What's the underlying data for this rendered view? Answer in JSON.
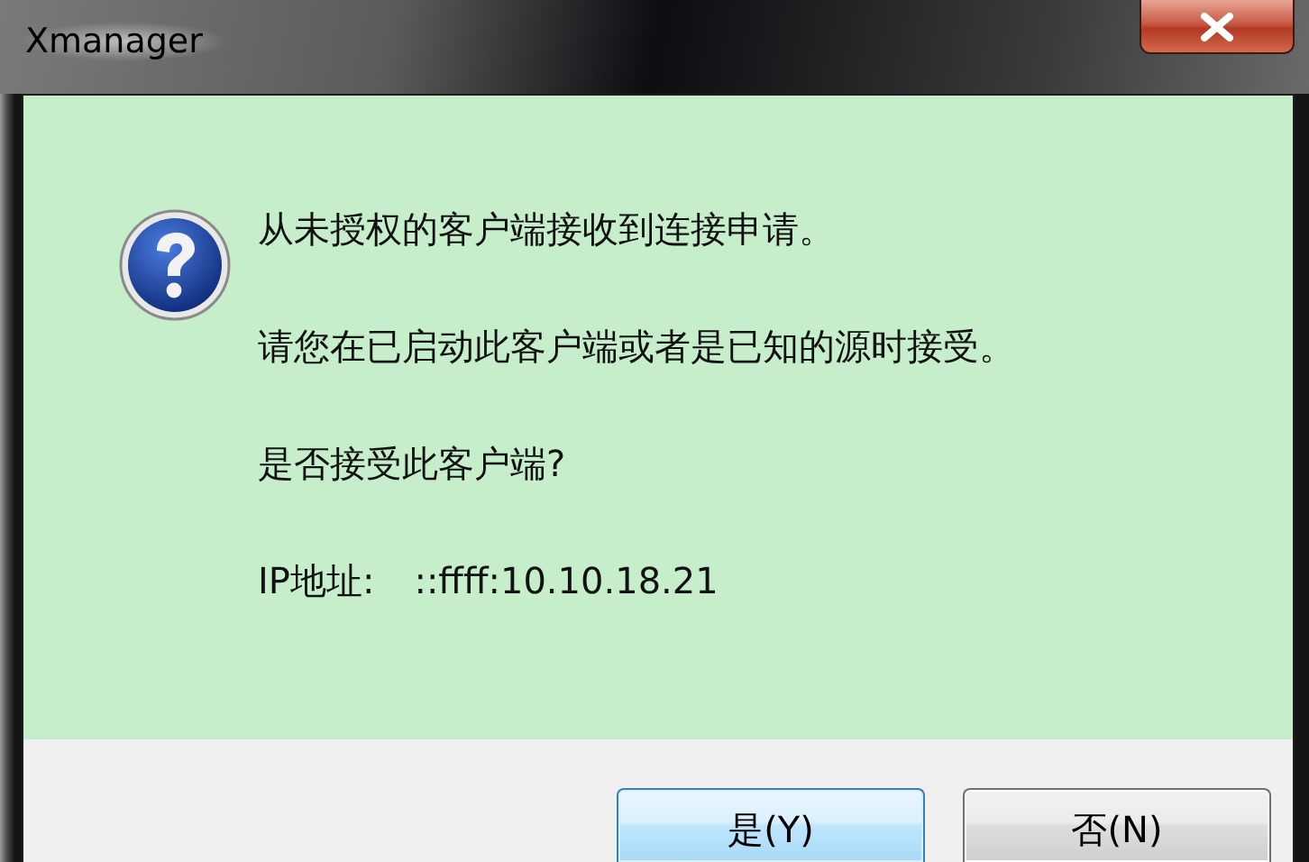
{
  "window": {
    "title": "Xmanager"
  },
  "message": {
    "lines": [
      "从未授权的客户端接收到连接申请。",
      "请您在已启动此客户端或者是已知的源时接受。",
      "是否接受此客户端?"
    ],
    "ip": {
      "label": "IP地址:",
      "value": "::ffff:10.10.18.21"
    }
  },
  "buttons": [
    {
      "label": "是(Y)",
      "default": true
    },
    {
      "label": "否(N)",
      "default": false
    }
  ]
}
